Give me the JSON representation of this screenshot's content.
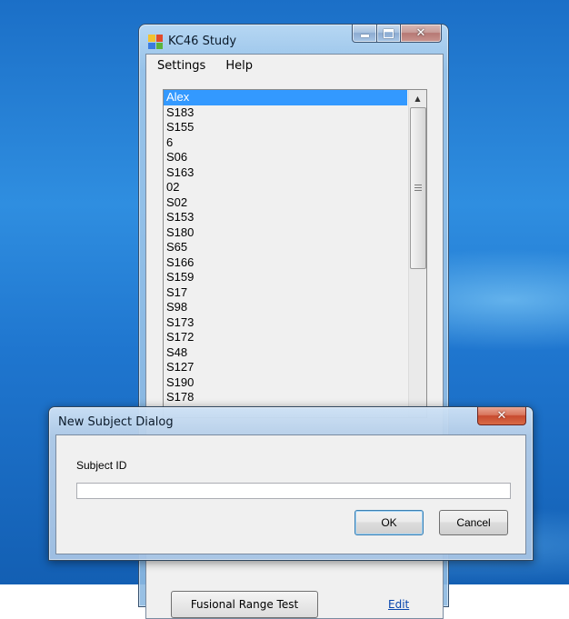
{
  "main_window": {
    "title": "KC46 Study",
    "menu": [
      "Settings",
      "Help"
    ],
    "subjects": [
      "Alex",
      "S183",
      "S155",
      "6",
      "S06",
      "S163",
      "02",
      "S02",
      "S153",
      "S180",
      "S65",
      "S166",
      "S159",
      "S17",
      "S98",
      "S173",
      "S172",
      "S48",
      "S127",
      "S190",
      "S178"
    ],
    "selected_subject": "Alex",
    "bottom_button_label": "Fusional Range Test",
    "bottom_link_label": "Edit"
  },
  "dialog": {
    "title": "New Subject Dialog",
    "field_label": "Subject ID",
    "field_value": "",
    "ok_label": "OK",
    "cancel_label": "Cancel"
  },
  "colors": {
    "selection": "#3399ff",
    "desktop": "#1f76cf",
    "close_button": "#c74a2f"
  },
  "icons": {
    "app": "app-icon",
    "minimize": "minimize-icon",
    "maximize": "maximize-icon",
    "close": "close-icon",
    "scroll_up": "chevron-up-icon"
  }
}
